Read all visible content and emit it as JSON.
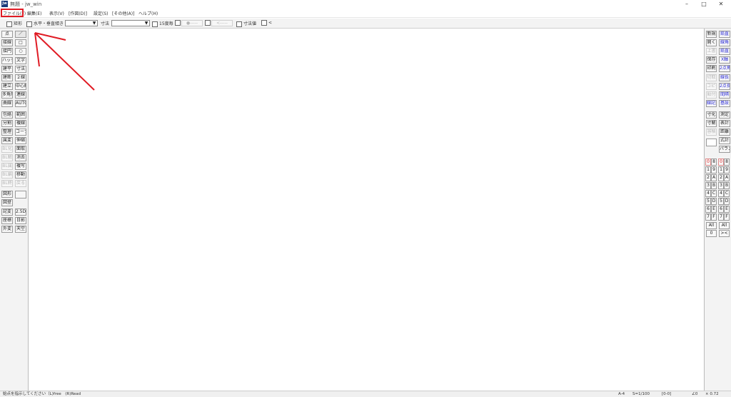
{
  "window": {
    "app_icon": "Jw",
    "title": "無題 - jw_win",
    "controls": [
      "–",
      "□",
      "✕"
    ]
  },
  "menu": [
    "ファイル(F)",
    "編集(E)",
    "表示(V)",
    "[作図(D)]",
    "設定(S)",
    "[その他(A)]",
    "ヘルプ(H)"
  ],
  "toolbar": {
    "rect_label": "矩形",
    "hv_label": "水平・垂直",
    "slope_label": "傾き",
    "dim_label": "寸法",
    "deg15_label": "15度毎",
    "dot_btn": "●-----",
    "arrow_btn": "<-----",
    "dimval_label": "寸法値",
    "lt_label": "<"
  },
  "left_col1": [
    "点",
    "接線",
    "接円",
    "ハッチ",
    "建平",
    "建断",
    "建立",
    "多角形",
    "曲線",
    "包絡",
    "分割",
    "整理",
    "属変",
    "BL化",
    "BL解",
    "BL属",
    "BL編",
    "BL終",
    "図形",
    "図登",
    "記変",
    "座標",
    "外変"
  ],
  "left_col2": [
    "／",
    "□",
    "○",
    "文字",
    "寸法",
    "２線",
    "中心線",
    "連線",
    "AUTO",
    "範囲",
    "複線",
    "コーナー",
    "伸縮",
    "面取",
    "消去",
    "複写",
    "移動",
    "戻る",
    "",
    "2.5D",
    "日影",
    "天空"
  ],
  "right_col1": [
    "新規",
    "開く",
    "上書",
    "保存",
    "印刷",
    "切取",
    "コピー",
    "貼付",
    "線記変",
    "寸化",
    "寸解",
    "容積",
    ""
  ],
  "right_col2": [
    "鉛直",
    "線角",
    "鉛直",
    "X軸",
    "2点角",
    "線長",
    "2点長",
    "間隔",
    "基設",
    "測定",
    "表計",
    "距離",
    "式計",
    "パラメ"
  ],
  "layers_left": [
    "0",
    "1",
    "2",
    "3",
    "4",
    "5",
    "6",
    "7",
    "All",
    "0"
  ],
  "layers_right": [
    "0",
    "1",
    "2",
    "3",
    "4",
    "5",
    "6",
    "7",
    "All",
    "><"
  ],
  "layers_right_letters": [
    "8",
    "9",
    "A",
    "B",
    "C",
    "D",
    "E",
    "F"
  ],
  "status": {
    "message": "始点を指示してください（L)free　(R)Read",
    "paper": "A-4",
    "scale": "S=1/100",
    "layer": "[0-0]",
    "angle": "∠0",
    "zoom": "× 0.72"
  },
  "colors": {
    "annotation_red": "#e01b24",
    "blue_text": "#2b2bd6"
  }
}
